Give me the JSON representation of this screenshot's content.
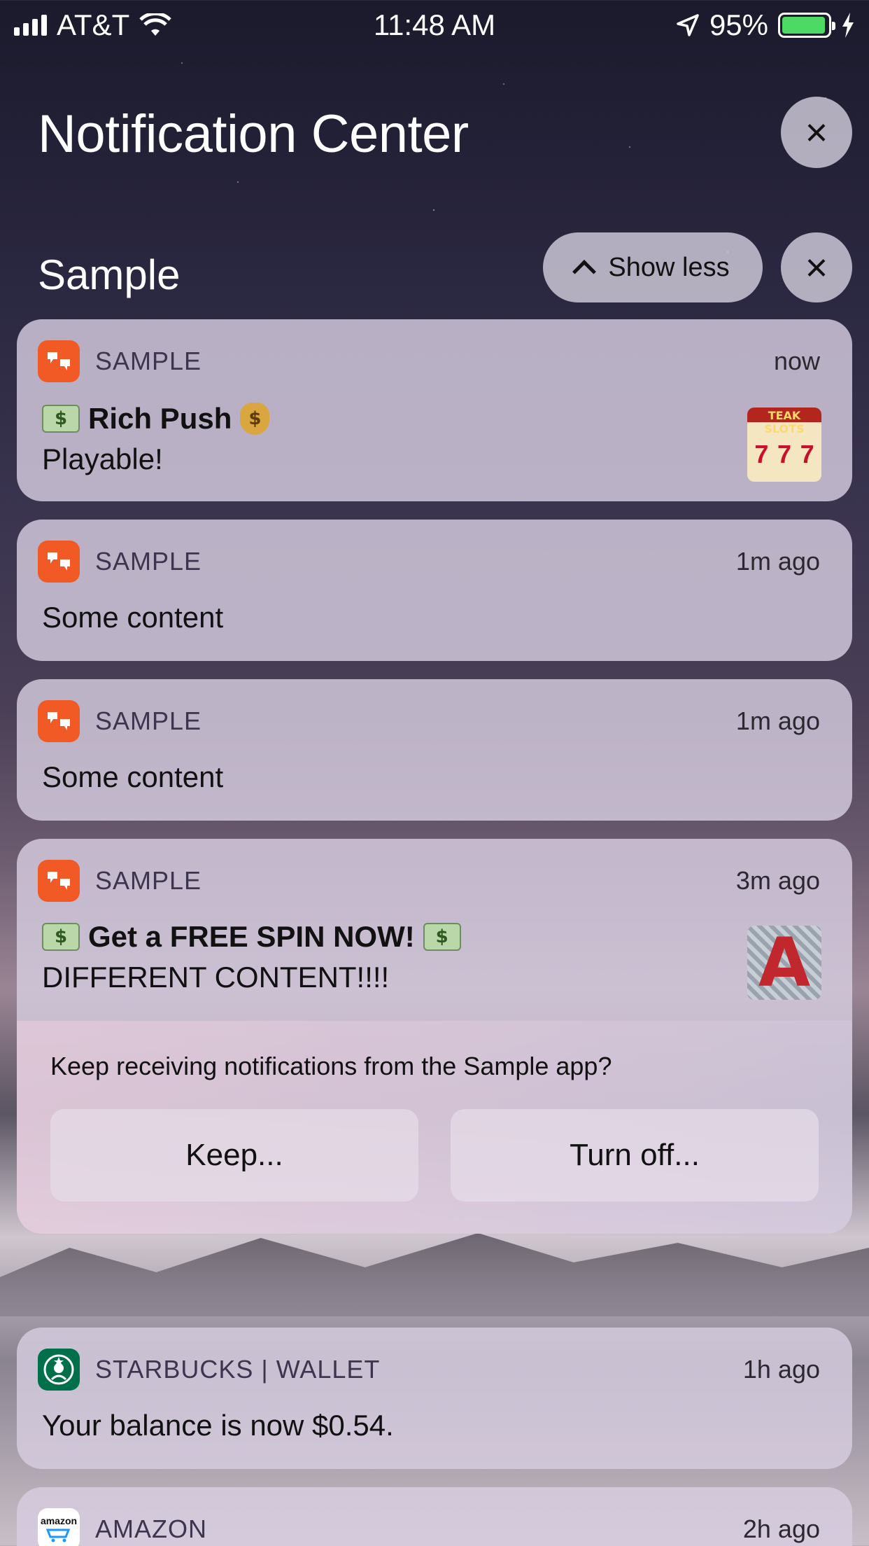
{
  "status_bar": {
    "carrier": "AT&T",
    "time": "11:48 AM",
    "battery": "95%",
    "battery_level": 0.95,
    "icons": [
      "signal-icon",
      "wifi-icon",
      "location-icon",
      "battery-icon",
      "charging-icon"
    ]
  },
  "header": {
    "title": "Notification Center",
    "close_icon": "×"
  },
  "group": {
    "title": "Sample",
    "show_less_label": "Show less",
    "close_icon": "×"
  },
  "notifications": [
    {
      "app": "SAMPLE",
      "time": "now",
      "title": "Rich Push",
      "body": "Playable!",
      "thumbnail_text": "TEAK SLOTS",
      "reels": [
        "7",
        "7",
        "7"
      ]
    },
    {
      "app": "SAMPLE",
      "time": "1m ago",
      "body": "Some content"
    },
    {
      "app": "SAMPLE",
      "time": "1m ago",
      "body": "Some content"
    },
    {
      "app": "SAMPLE",
      "time": "3m ago",
      "title": "Get a FREE SPIN NOW!",
      "body": "DIFFERENT CONTENT!!!!",
      "thumbnail_letter": "A",
      "prompt": "Keep receiving notifications from the Sample app?",
      "keep_label": "Keep...",
      "turn_off_label": "Turn off..."
    },
    {
      "app": "STARBUCKS | WALLET",
      "time": "1h ago",
      "body": "Your balance is now $0.54."
    },
    {
      "app": "AMAZON",
      "time": "2h ago",
      "icon_text": "amazon"
    }
  ],
  "emoji": {
    "money_bill": "$",
    "money_bag": "$",
    "flying_money": "$"
  },
  "colors": {
    "sample_brand": "#f15a24",
    "starbucks_brand": "#00704a",
    "battery_green": "#4cd964"
  }
}
